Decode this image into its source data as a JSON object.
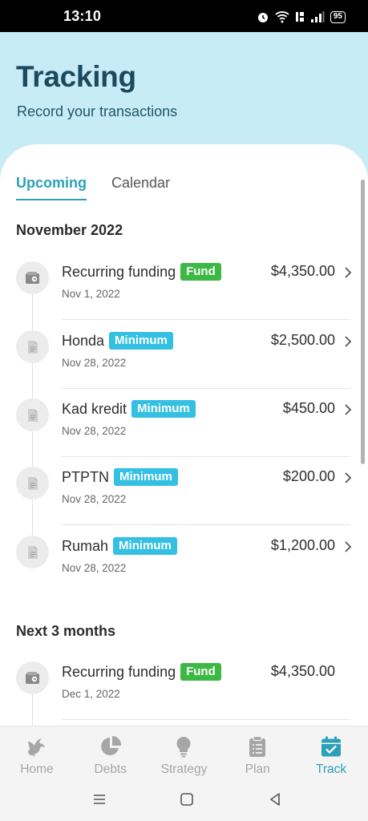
{
  "status_bar": {
    "time": "13:10",
    "battery": "95"
  },
  "header": {
    "title": "Tracking",
    "subtitle": "Record your transactions"
  },
  "tabs": [
    {
      "label": "Upcoming",
      "active": true
    },
    {
      "label": "Calendar",
      "active": false
    }
  ],
  "sections": [
    {
      "title": "November 2022",
      "items": [
        {
          "name": "Recurring funding",
          "badge": "Fund",
          "badge_type": "fund",
          "date": "Nov 1, 2022",
          "amount": "$4,350.00",
          "icon": "wallet-icon"
        },
        {
          "name": "Honda",
          "badge": "Minimum",
          "badge_type": "min",
          "date": "Nov 28, 2022",
          "amount": "$2,500.00",
          "icon": "document-icon"
        },
        {
          "name": "Kad kredit",
          "badge": "Minimum",
          "badge_type": "min",
          "date": "Nov 28, 2022",
          "amount": "$450.00",
          "icon": "document-icon"
        },
        {
          "name": "PTPTN",
          "badge": "Minimum",
          "badge_type": "min",
          "date": "Nov 28, 2022",
          "amount": "$200.00",
          "icon": "document-icon"
        },
        {
          "name": "Rumah",
          "badge": "Minimum",
          "badge_type": "min",
          "date": "Nov 28, 2022",
          "amount": "$1,200.00",
          "icon": "document-icon"
        }
      ]
    },
    {
      "title": "Next 3 months",
      "items": [
        {
          "name": "Recurring funding",
          "badge": "Fund",
          "badge_type": "fund",
          "date": "Dec 1, 2022",
          "amount": "$4,350.00",
          "icon": "wallet-icon"
        }
      ]
    }
  ],
  "nav": [
    {
      "label": "Home",
      "icon": "bird-icon",
      "active": false
    },
    {
      "label": "Debts",
      "icon": "pie-chart-icon",
      "active": false
    },
    {
      "label": "Strategy",
      "icon": "lightbulb-icon",
      "active": false
    },
    {
      "label": "Plan",
      "icon": "clipboard-icon",
      "active": false
    },
    {
      "label": "Track",
      "icon": "calendar-check-icon",
      "active": true
    }
  ],
  "colors": {
    "accent": "#2ba1b9",
    "header_bg": "#c8ecf5",
    "fund_badge": "#3cb944",
    "minimum_badge": "#33c0e2"
  }
}
